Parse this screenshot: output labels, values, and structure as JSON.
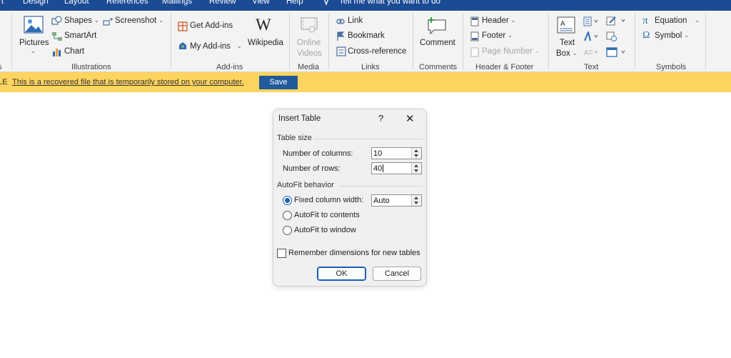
{
  "tabs": [
    "rt",
    "Design",
    "Layout",
    "References",
    "Mailings",
    "Review",
    "View",
    "Help"
  ],
  "tell_me": "Tell me what you want to do",
  "ribbon": {
    "groups": {
      "illustrations": "Illustrations",
      "addins": "Add-ins",
      "media": "Media",
      "links": "Links",
      "comments": "Comments",
      "header_footer": "Header & Footer",
      "text": "Text",
      "symbols": "Symbols",
      "left_partial": "s"
    },
    "illustrations": {
      "pictures": "Pictures",
      "shapes": "Shapes",
      "smartart": "SmartArt",
      "chart": "Chart",
      "screenshot": "Screenshot"
    },
    "addins": {
      "get": "Get Add-ins",
      "my": "My Add-ins",
      "wikipedia": "Wikipedia"
    },
    "media": {
      "online_1": "Online",
      "online_2": "Videos"
    },
    "links": {
      "link": "Link",
      "bookmark": "Bookmark",
      "cross_reference": "Cross-reference"
    },
    "comments": {
      "comment": "Comment"
    },
    "header_footer": {
      "header": "Header",
      "footer": "Footer",
      "page_number": "Page Number"
    },
    "text": {
      "textbox_1": "Text",
      "textbox_2": "Box"
    },
    "symbols": {
      "equation": "Equation",
      "symbol": "Symbol"
    }
  },
  "message_bar": {
    "label": "LE",
    "message": "This is a recovered file that is temporarily stored on your computer.",
    "save": "Save"
  },
  "dialog": {
    "title": "Insert Table",
    "help": "?",
    "close": "✕",
    "table_size": "Table size",
    "columns_label": "Number of columns:",
    "columns_value": "10",
    "rows_label": "Number of rows:",
    "rows_value": "40",
    "autofit_behavior": "AutoFit behavior",
    "fixed_label": "Fixed column width:",
    "fixed_value": "Auto",
    "autofit_contents": "AutoFit to contents",
    "autofit_window": "AutoFit to window",
    "remember": "Remember dimensions for new tables",
    "ok": "OK",
    "cancel": "Cancel"
  },
  "colors": {
    "tab_bar": "#1b4b94",
    "message_bar": "#fcd45e",
    "save_button": "#215a9c",
    "accent": "#1a5fb4"
  }
}
